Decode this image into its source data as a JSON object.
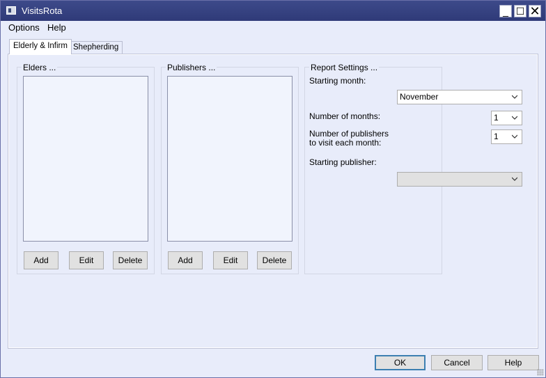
{
  "window": {
    "title": "VisitsRota"
  },
  "titlebar": {
    "minimize_glyph": "_",
    "maximize_glyph": "☐",
    "close_glyph": "✕"
  },
  "menu": {
    "options": "Options",
    "help": "Help"
  },
  "tabs": [
    {
      "label": "Elderly & Infirm",
      "selected": true
    },
    {
      "label": "Shepherding",
      "selected": false
    }
  ],
  "elders": {
    "title": "Elders ...",
    "add": "Add",
    "edit": "Edit",
    "delete": "Delete",
    "items": []
  },
  "publishers": {
    "title": "Publishers ...",
    "add": "Add",
    "edit": "Edit",
    "delete": "Delete",
    "items": []
  },
  "report": {
    "title": "Report Settings ...",
    "starting_month_label": "Starting month:",
    "starting_month_value": "November",
    "num_months_label": "Number of months:",
    "num_months_value": "1",
    "pubs_per_month_label": "Number of publishers to visit each month:",
    "pubs_per_month_value": "1",
    "starting_publisher_label": "Starting publisher:",
    "starting_publisher_value": ""
  },
  "footer": {
    "ok": "OK",
    "cancel": "Cancel",
    "help": "Help"
  }
}
